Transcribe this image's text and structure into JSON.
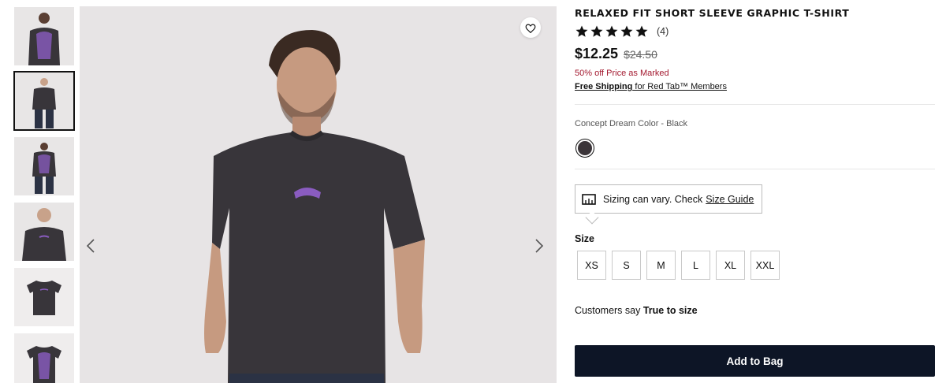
{
  "product": {
    "title": "RELAXED FIT SHORT SLEEVE GRAPHIC T-SHIRT",
    "rating": 5,
    "review_count": "(4)",
    "price_sale": "$12.25",
    "price_original": "$24.50",
    "discount_text": "50% off Price as Marked",
    "shipping_link": "Free Shipping",
    "shipping_rest": " for Red Tab™ Members"
  },
  "color": {
    "label": "Concept Dream Color - Black",
    "swatch_hex": "#3b3539"
  },
  "sizing_tip": {
    "text": "Sizing can vary. Check",
    "link": "Size Guide"
  },
  "size": {
    "label": "Size",
    "options": [
      "XS",
      "S",
      "M",
      "L",
      "XL",
      "XXL"
    ]
  },
  "fit": {
    "prefix": "Customers say ",
    "value": "True to size"
  },
  "add_to_bag": "Add to Bag",
  "gallery": {
    "thumbnail_count": 6,
    "selected_thumbnail": 2
  },
  "colors": {
    "button_bg": "#0d1526",
    "discount": "#a3192f",
    "shirt": "#38353a",
    "graphic": "#8a5cc0"
  }
}
